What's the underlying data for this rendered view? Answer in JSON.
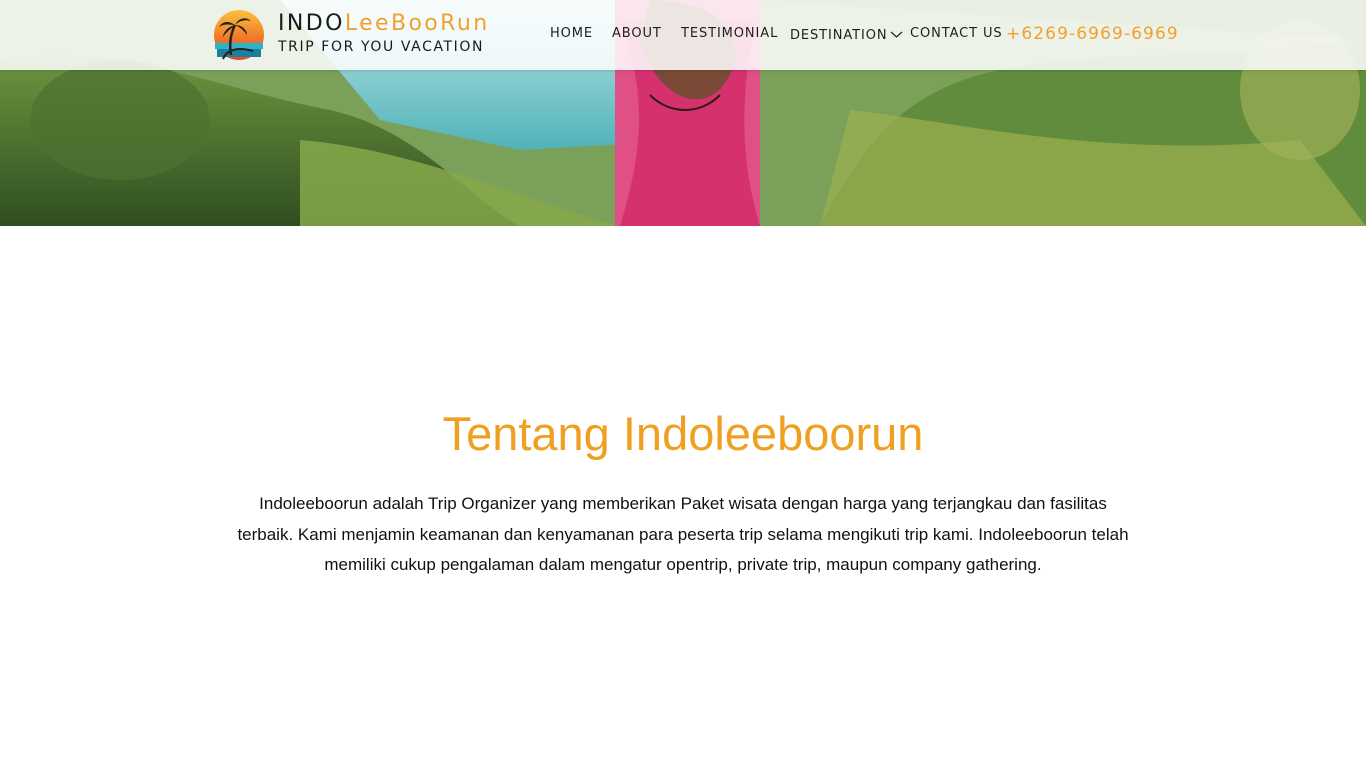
{
  "header": {
    "brand_prefix": "INDO",
    "brand_suffix": "LeeBooRun",
    "tagline": "TRIP FOR YOU VACATION",
    "logo_icon": "palm-sunset-logo-icon"
  },
  "nav": {
    "home": "HOME",
    "about": "ABOUT",
    "testimonial": "TESTIMONIAL",
    "destination": "DESTINATION",
    "contact": "CONTACT US",
    "dropdown_icon": "chevron-down-icon",
    "phone": "+6269-6969-6969"
  },
  "about": {
    "title": "Tentang Indoleeboorun",
    "description": "Indoleeboorun adalah Trip Organizer yang memberikan Paket wisata dengan harga yang terjangkau dan fasilitas terbaik. Kami menjamin keamanan dan kenyamanan para peserta trip selama mengikuti trip kami. Indoleeboorun telah memiliki cukup pengalaman dalam mengatur opentrip, private trip, maupun company gathering."
  },
  "colors": {
    "accent": "#f0a030",
    "text": "#1a1a1a",
    "navbar_bg": "#ffffff"
  }
}
